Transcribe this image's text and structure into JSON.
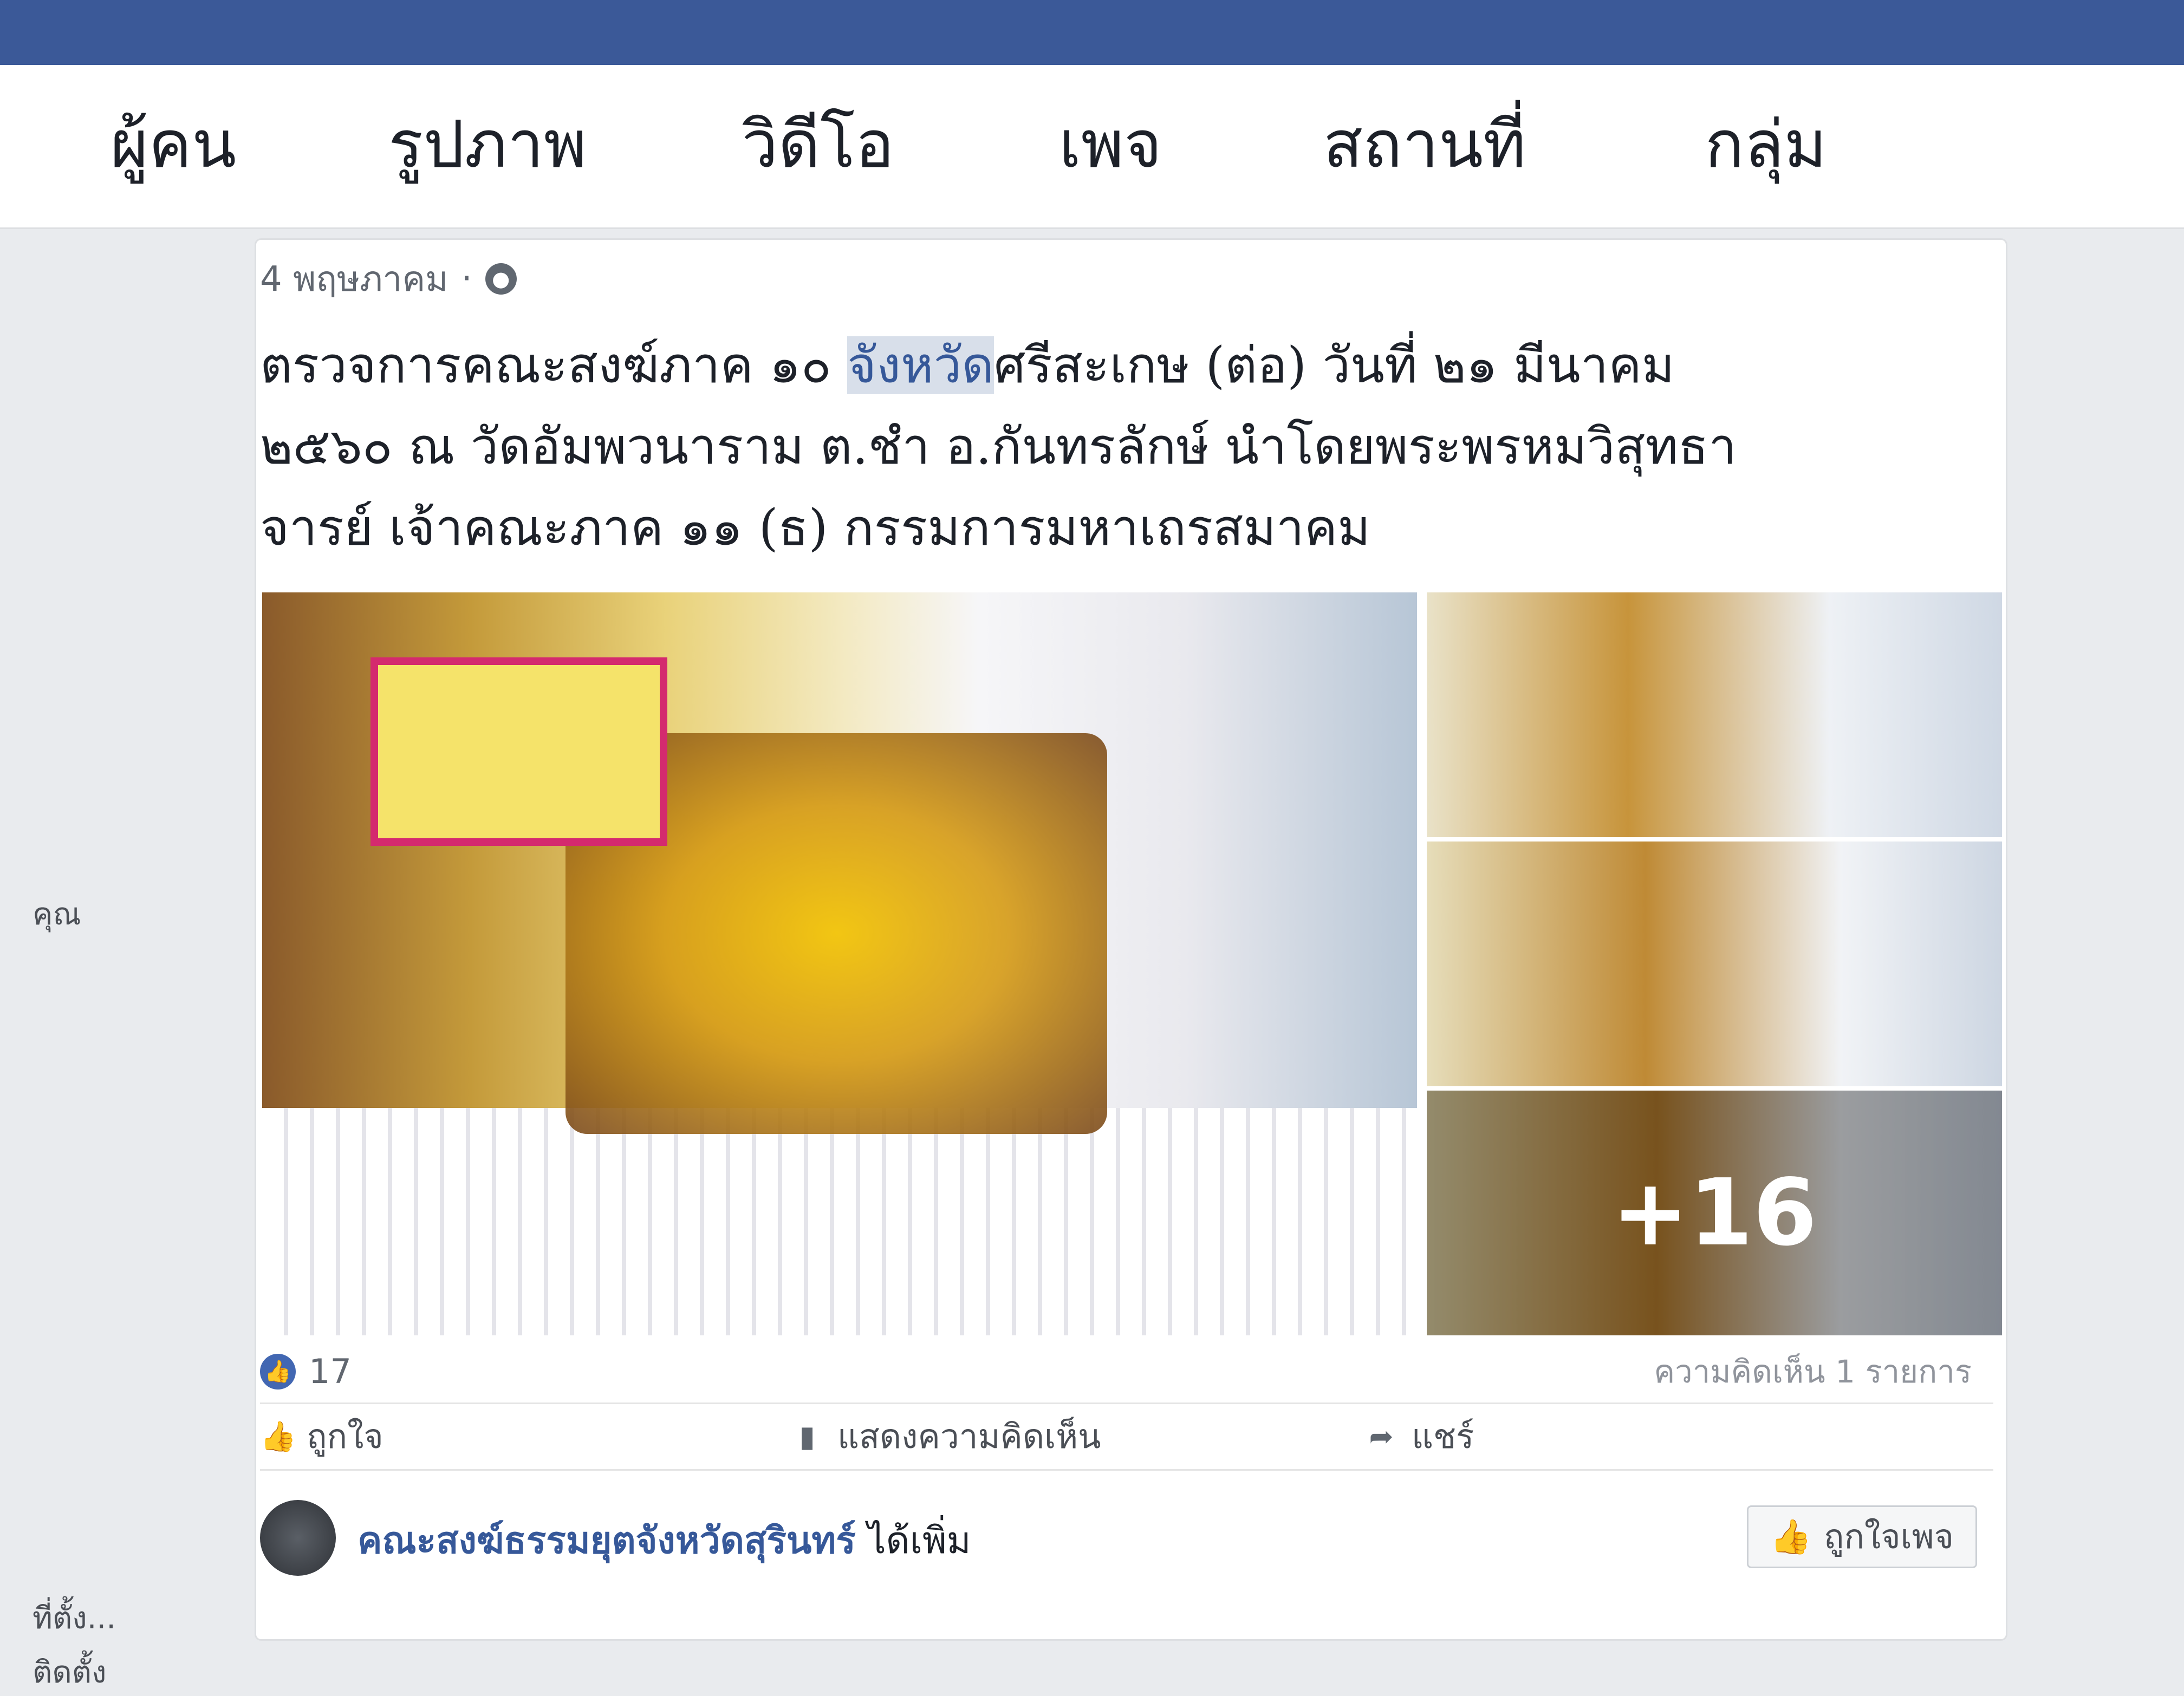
{
  "nav": {
    "items": [
      {
        "label": "ผู้คน"
      },
      {
        "label": "รูปภาพ"
      },
      {
        "label": "วิดีโอ"
      },
      {
        "label": "เพจ"
      },
      {
        "label": "สถานที่"
      },
      {
        "label": "กลุ่ม"
      }
    ]
  },
  "sidebar": {
    "lines": [
      "คุณ",
      "ที่ตั้ง...",
      "ติดตั้ง"
    ]
  },
  "post": {
    "date": "4 พฤษภาคม",
    "separator": "·",
    "text_line1_before": "ตรวจการคณะสงฆ์ภาค ๑๐ ",
    "text_line1_highlight": "จังหวัด",
    "text_line1_after": "ศรีสะเกษ (ต่อ) วันที่ ๒๑ มีนาคม",
    "text_line2": "๒๕๖๐ ณ วัดอัมพวนาราม ต.ชำ อ.กันทรลักษ์ นำโดยพระพรหมวิสุทธา",
    "text_line3": "จารย์ เจ้าคณะภาค ๑๑ (ธ) กรรมการมหาเถรสมาคม",
    "more_photos": "+16",
    "likes_count": "17",
    "comments_count": "ความคิดเห็น 1 รายการ"
  },
  "actions": {
    "like": "ถูกใจ",
    "comments": "แสดงความคิดเห็น",
    "share": "แชร์"
  },
  "shared": {
    "page_name": "คณะสงฆ์ธรรมยุตจังหวัดสุรินทร์",
    "suffix": " ได้เพิ่ม",
    "page_like": "ถูกใจเพจ"
  },
  "colors": {
    "topbar": "#3b5998",
    "link": "#365899",
    "highlight": "#d8dfea"
  }
}
